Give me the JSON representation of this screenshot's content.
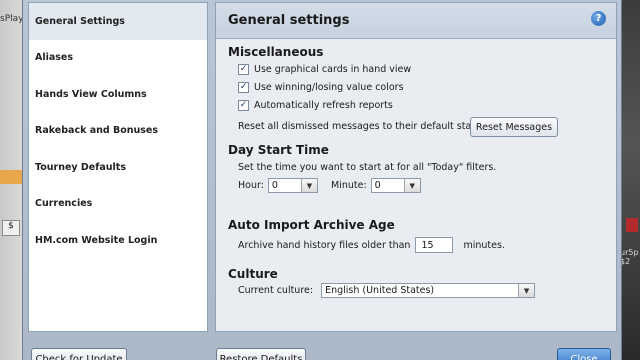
{
  "background": {
    "left_text": "sPlay",
    "left_box": "$",
    "right_text": "ur5p $2"
  },
  "sidebar": {
    "items": [
      {
        "label": "General Settings"
      },
      {
        "label": "Aliases"
      },
      {
        "label": "Hands View Columns"
      },
      {
        "label": "Rakeback and Bonuses"
      },
      {
        "label": "Tourney Defaults"
      },
      {
        "label": "Currencies"
      },
      {
        "label": "HM.com Website Login"
      }
    ]
  },
  "panel": {
    "title": "General settings",
    "help_icon": "?",
    "misc": {
      "title": "Miscellaneous",
      "checkboxes": [
        {
          "label": "Use graphical cards in hand view",
          "checked": true
        },
        {
          "label": "Use winning/losing value colors",
          "checked": true
        },
        {
          "label": "Automatically refresh reports",
          "checked": true
        }
      ],
      "reset_text": "Reset all dismissed messages to their default state:",
      "reset_button": "Reset Messages"
    },
    "day_start": {
      "title": "Day Start Time",
      "description": "Set the time you want to start at for all \"Today\" filters.",
      "hour_label": "Hour:",
      "hour_value": "0",
      "minute_label": "Minute:",
      "minute_value": "0"
    },
    "auto_import": {
      "title": "Auto Import Archive Age",
      "prefix": "Archive hand history files older than",
      "value": "15",
      "suffix": "minutes."
    },
    "culture": {
      "title": "Culture",
      "label": "Current culture:",
      "value": "English (United States)"
    }
  },
  "footer": {
    "check_update": "Check for Update",
    "restore_defaults": "Restore Defaults",
    "close": "Close"
  }
}
